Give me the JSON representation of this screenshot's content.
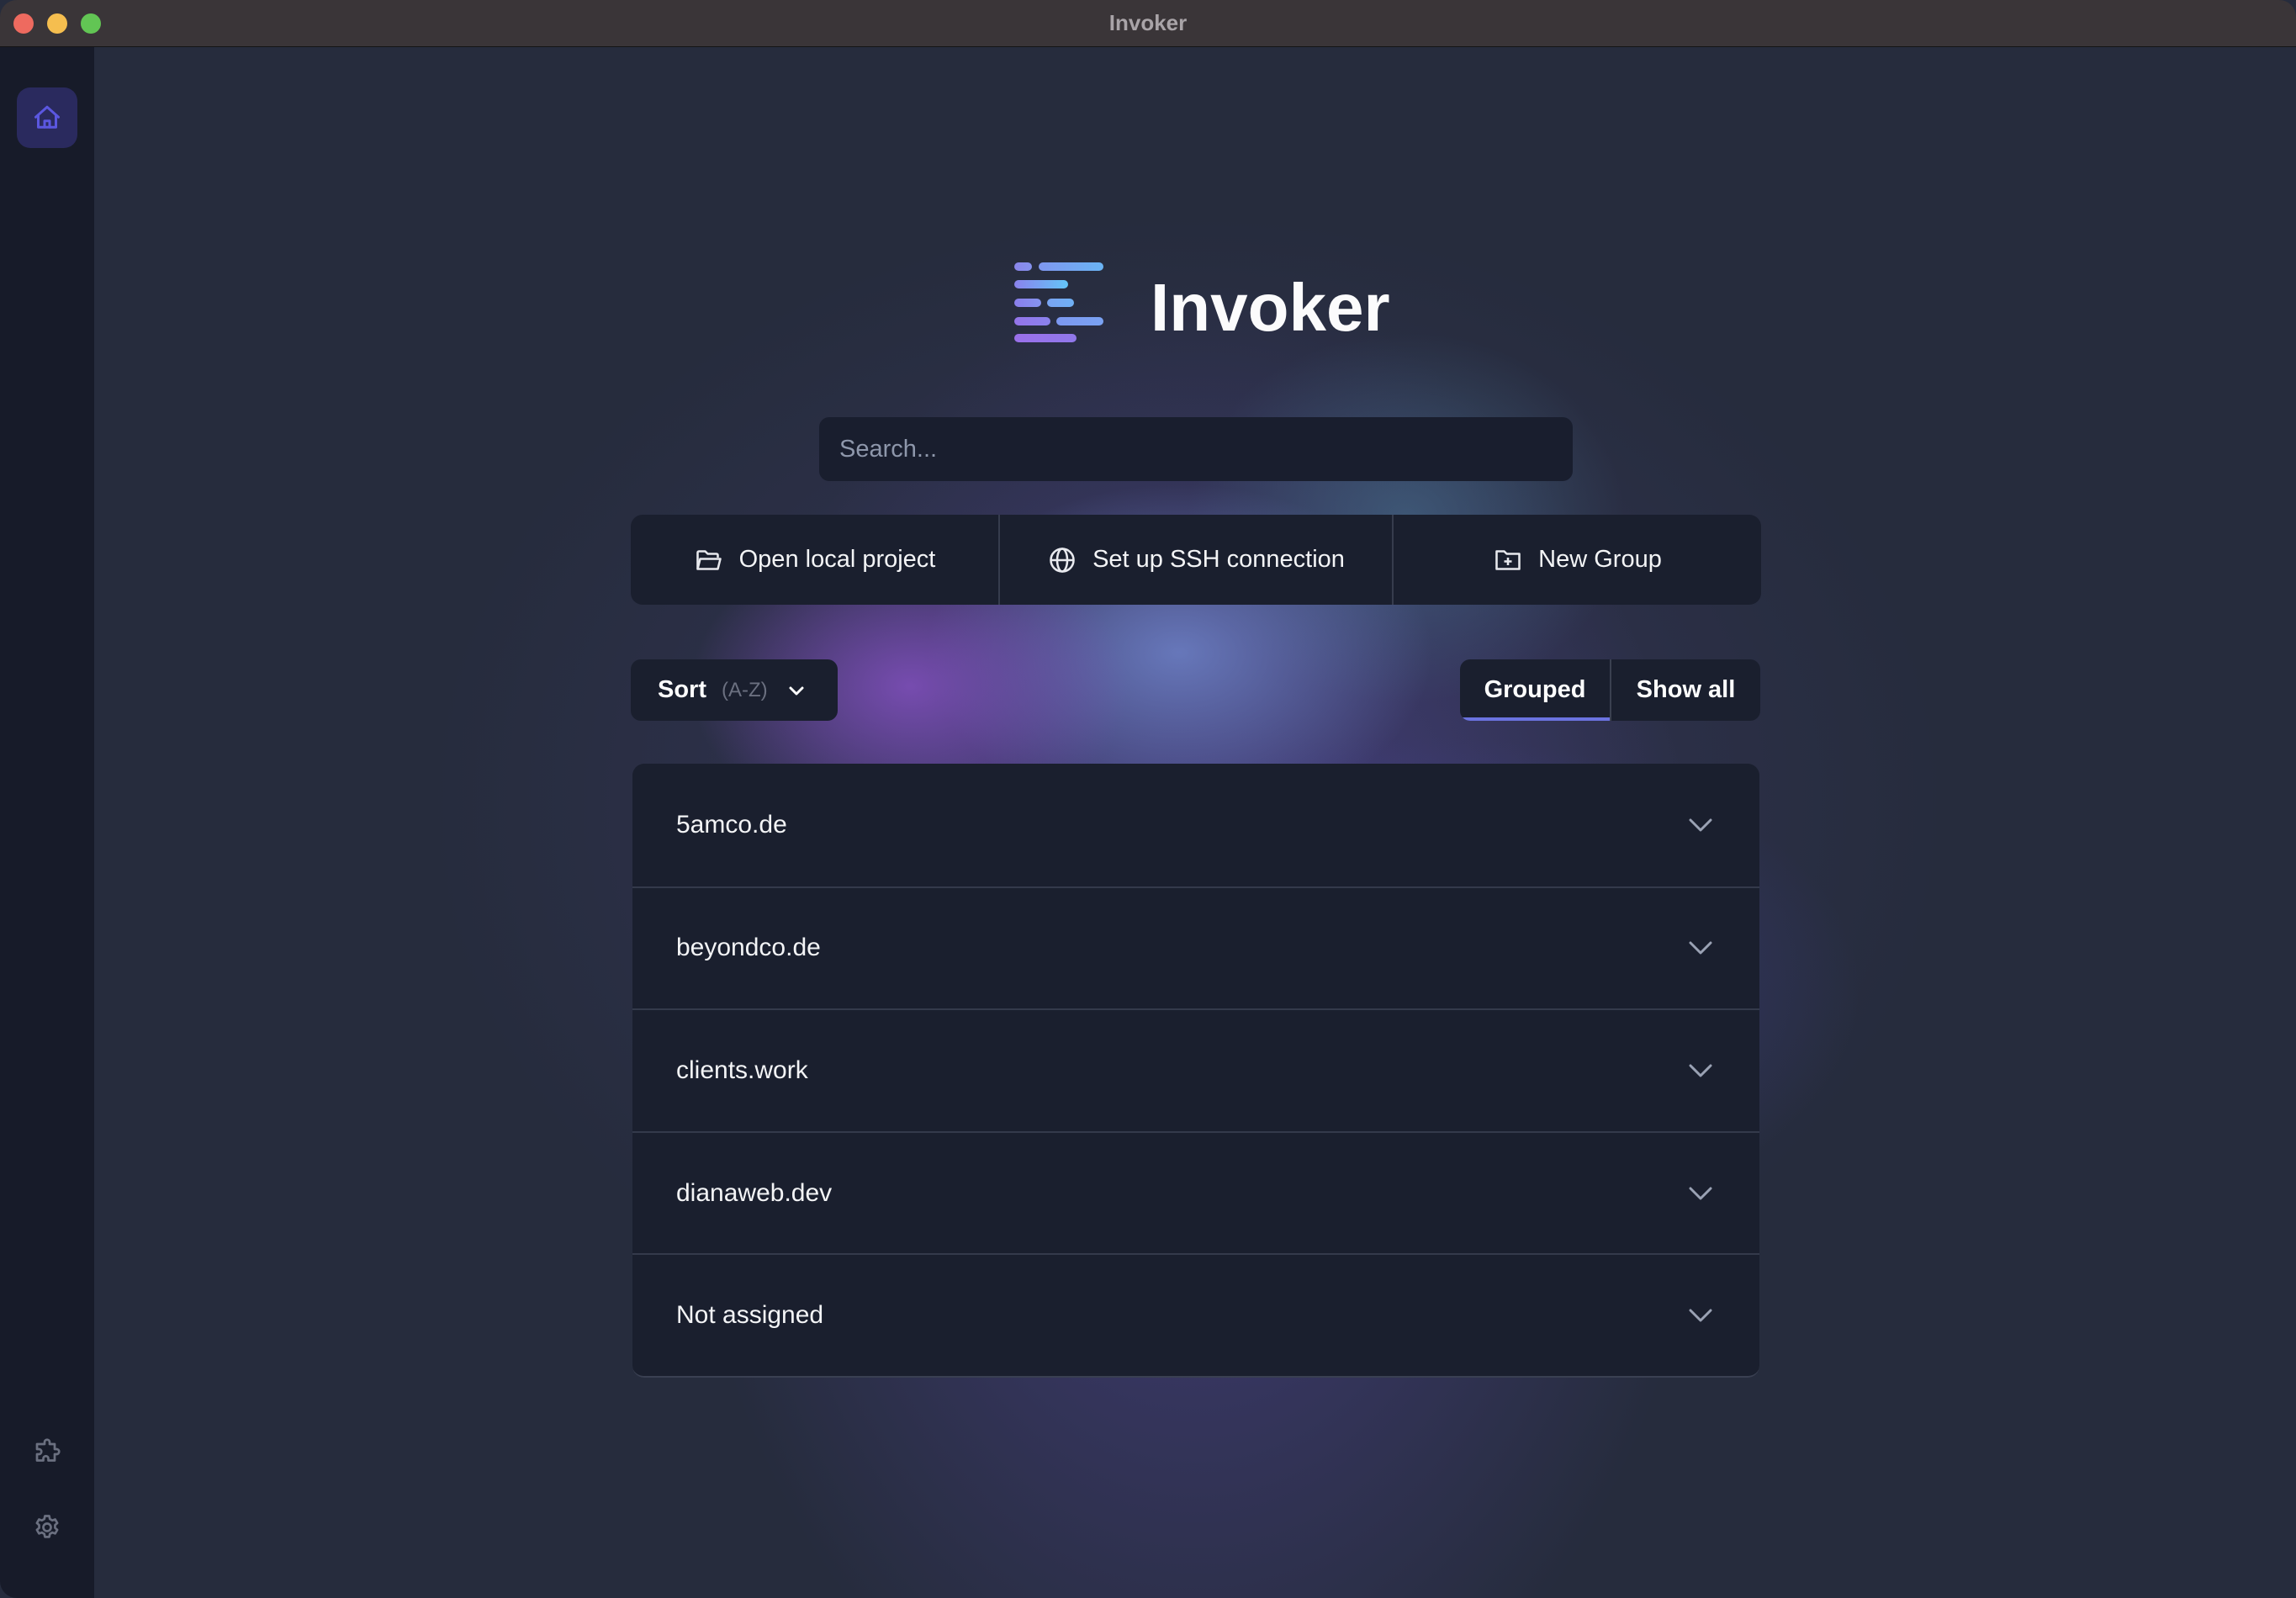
{
  "window": {
    "title": "Invoker",
    "traffic_lights": [
      "close",
      "minimize",
      "zoom"
    ]
  },
  "sidebar": {
    "items": [
      {
        "name": "home",
        "icon": "home-icon",
        "active": true
      },
      {
        "name": "plugins",
        "icon": "puzzle-icon",
        "active": false
      },
      {
        "name": "settings",
        "icon": "gear-icon",
        "active": false
      }
    ]
  },
  "brand": {
    "name": "Invoker",
    "logo_icon": "lines-logo-icon"
  },
  "search": {
    "value": "",
    "placeholder": "Search..."
  },
  "actions": [
    {
      "label": "Open local project",
      "icon": "folder-open-icon"
    },
    {
      "label": "Set up SSH connection",
      "icon": "globe-icon"
    },
    {
      "label": "New Group",
      "icon": "folder-plus-icon"
    }
  ],
  "sort": {
    "label": "Sort",
    "value": "(A-Z)",
    "icon": "chevron-down-icon"
  },
  "view_toggle": {
    "options": [
      "Grouped",
      "Show all"
    ],
    "selected": "Grouped"
  },
  "groups": [
    {
      "name": "5amco.de",
      "expanded": false
    },
    {
      "name": "beyondco.de",
      "expanded": false
    },
    {
      "name": "clients.work",
      "expanded": false
    },
    {
      "name": "dianaweb.dev",
      "expanded": false
    },
    {
      "name": "Not assigned",
      "expanded": false
    }
  ],
  "colors": {
    "accent": "#6b73e0",
    "home_active_bg": "#2a2a5e",
    "home_icon": "#5b57e0",
    "panel_bg": "#1a1f2e",
    "page_bg": "#262c3d",
    "sidebar_bg": "#171b29"
  }
}
